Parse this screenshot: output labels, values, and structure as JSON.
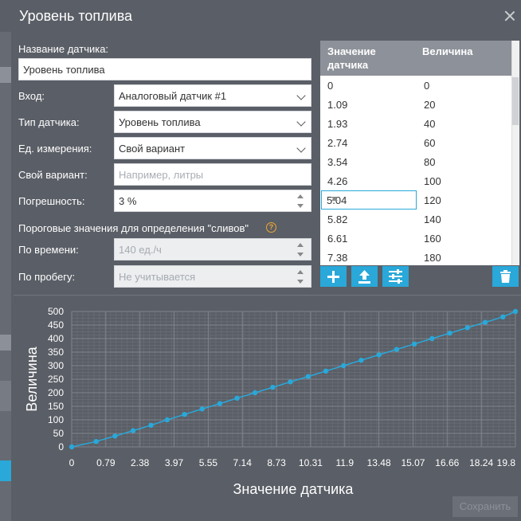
{
  "dialog": {
    "title": "Уровень топлива",
    "save_label": "Сохранить"
  },
  "form": {
    "name_label": "Название датчика:",
    "name_value": "Уровень топлива",
    "input_label": "Вход:",
    "input_value": "Аналоговый датчик #1",
    "type_label": "Тип датчика:",
    "type_value": "Уровень топлива",
    "unit_label": "Ед. измерения:",
    "unit_value": "Свой вариант",
    "custom_label": "Свой вариант:",
    "custom_placeholder": "Например, литры",
    "error_label": "Погрешность:",
    "error_value": "3  %",
    "thresholds_title": "Пороговые значения для определения \"сливов\"",
    "by_time_label": "По времени:",
    "by_time_placeholder": "140 ед./ч",
    "by_mileage_label": "По пробегу:",
    "by_mileage_placeholder": "Не учитывается"
  },
  "table": {
    "col1_line1": "Значение",
    "col1_line2": "датчика",
    "col2": "Величина",
    "rows": [
      {
        "sensor": "0",
        "value": "0"
      },
      {
        "sensor": "1.09",
        "value": "20"
      },
      {
        "sensor": "1.93",
        "value": "40"
      },
      {
        "sensor": "2.74",
        "value": "60"
      },
      {
        "sensor": "3.54",
        "value": "80"
      },
      {
        "sensor": "4.26",
        "value": "100"
      },
      {
        "sensor": "5.04",
        "value": "120"
      },
      {
        "sensor": "5.82",
        "value": "140"
      },
      {
        "sensor": "6.61",
        "value": "160"
      },
      {
        "sensor": "7.38",
        "value": "180"
      }
    ]
  },
  "colors": {
    "accent": "#29a8d9",
    "background": "#5a5e66"
  },
  "icons": [
    "plus-icon",
    "upload-icon",
    "sliders-icon",
    "trash-icon",
    "question-icon",
    "close-icon",
    "chevron-down-icon"
  ],
  "chart_data": {
    "type": "line",
    "xlabel": "Значение датчика",
    "ylabel": "Величина",
    "x_ticks": [
      "0",
      "0.79",
      "2.38",
      "3.97",
      "5.55",
      "7.14",
      "8.73",
      "10.31",
      "11.9",
      "13.48",
      "15.07",
      "16.66",
      "18.24",
      "19.8"
    ],
    "y_ticks": [
      0,
      50,
      100,
      150,
      200,
      250,
      300,
      350,
      400,
      450,
      500
    ],
    "xlim": [
      0,
      19.8
    ],
    "ylim": [
      0,
      500
    ],
    "grid": true,
    "series": [
      {
        "x": [
          0,
          1.09,
          1.93,
          2.74,
          3.54,
          4.26,
          5.04,
          5.82,
          6.61,
          7.38,
          8.18,
          8.97,
          9.76,
          10.55,
          11.34,
          12.13,
          12.92,
          13.71,
          14.5,
          15.29,
          16.08,
          16.87,
          17.66,
          18.45,
          19.24,
          19.8
        ],
        "y": [
          0,
          20,
          40,
          60,
          80,
          100,
          120,
          140,
          160,
          180,
          200,
          220,
          240,
          260,
          280,
          300,
          320,
          340,
          360,
          380,
          400,
          420,
          440,
          460,
          480,
          500
        ]
      }
    ]
  }
}
